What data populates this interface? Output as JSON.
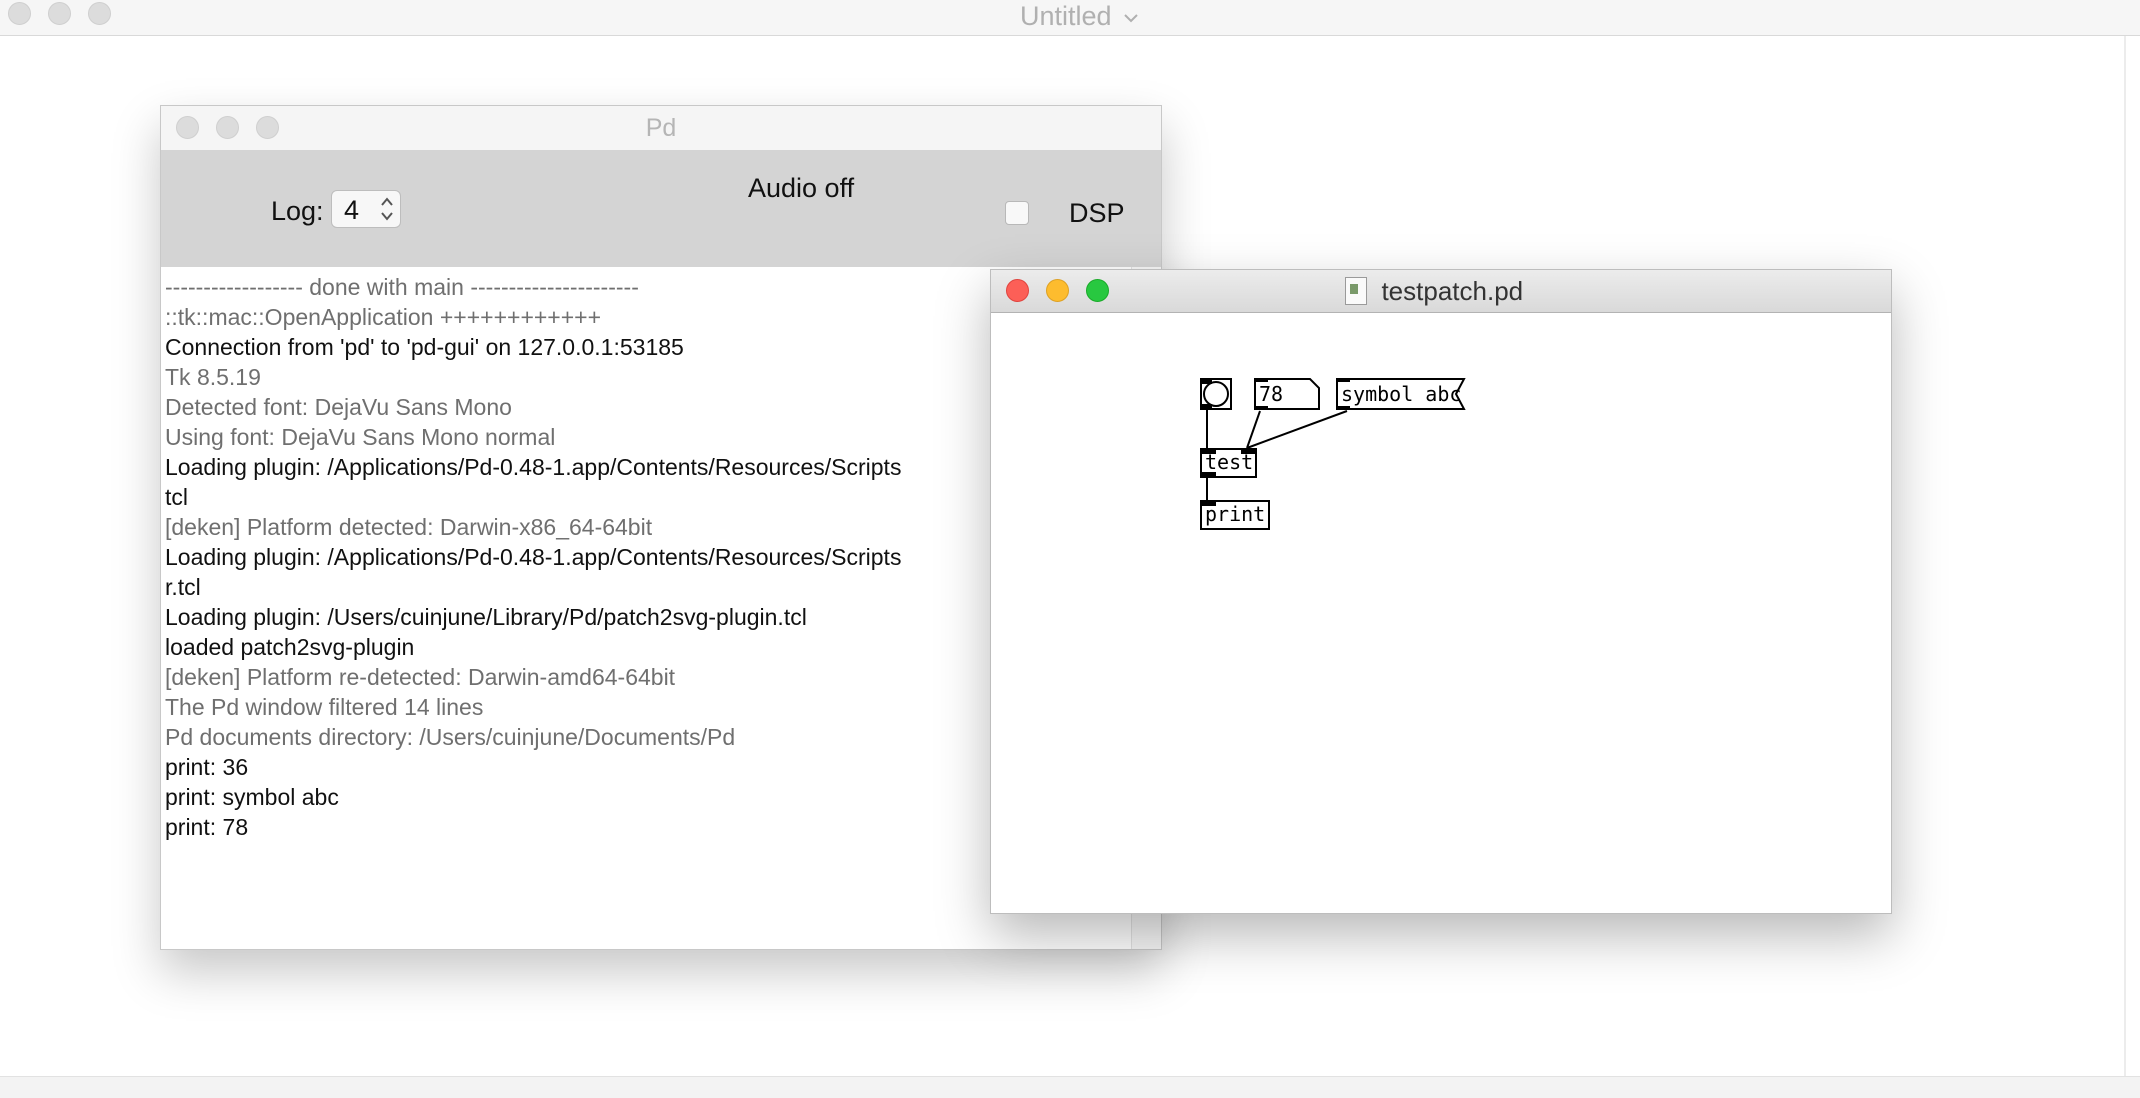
{
  "background_window": {
    "title": "Untitled",
    "title_chevron": "chevron-down-icon"
  },
  "pd_window": {
    "title": "Pd",
    "log_label": "Log:",
    "log_value": "4",
    "audio_status": "Audio off",
    "dsp_label": "DSP",
    "dsp_checked": false,
    "console_lines": [
      {
        "text": "------------------ done with main ----------------------",
        "color": "#6f6f6f"
      },
      {
        "text": "::tk::mac::OpenApplication  ++++++++++++",
        "color": "#6f6f6f"
      },
      {
        "text": "Connection from 'pd' to 'pd-gui' on 127.0.0.1:53185",
        "color": "#111111"
      },
      {
        "text": "Tk 8.5.19",
        "color": "#6f6f6f"
      },
      {
        "text": "Detected font: DejaVu Sans Mono",
        "color": "#6f6f6f"
      },
      {
        "text": "Using font: DejaVu Sans Mono normal",
        "color": "#6f6f6f"
      },
      {
        "text": "Loading plugin: /Applications/Pd-0.48-1.app/Contents/Resources/Scripts",
        "color": "#111111"
      },
      {
        "text": "tcl",
        "color": "#111111"
      },
      {
        "text": "[deken] Platform detected: Darwin-x86_64-64bit",
        "color": "#6f6f6f"
      },
      {
        "text": "Loading plugin: /Applications/Pd-0.48-1.app/Contents/Resources/Scripts",
        "color": "#111111"
      },
      {
        "text": "r.tcl",
        "color": "#111111"
      },
      {
        "text": "Loading plugin: /Users/cuinjune/Library/Pd/patch2svg-plugin.tcl",
        "color": "#111111"
      },
      {
        "text": "loaded patch2svg-plugin",
        "color": "#111111"
      },
      {
        "text": "[deken] Platform re-detected: Darwin-amd64-64bit",
        "color": "#6f6f6f"
      },
      {
        "text": "The Pd window filtered 14 lines",
        "color": "#6f6f6f"
      },
      {
        "text": "Pd documents directory: /Users/cuinjune/Documents/Pd",
        "color": "#6f6f6f"
      },
      {
        "text": "print: 36",
        "color": "#111111"
      },
      {
        "text": "print: symbol abc",
        "color": "#111111"
      },
      {
        "text": "print: 78",
        "color": "#111111"
      }
    ]
  },
  "patch_window": {
    "title": "testpatch.pd",
    "objects": {
      "number_value": "78",
      "symbol_message": "symbol abc",
      "test_object": "test",
      "print_object": "print"
    }
  },
  "colors": {
    "close": "#fc5f57",
    "minimize": "#fdbc2e",
    "zoom": "#28c840",
    "toolbar_bg": "#d4d4d4"
  }
}
